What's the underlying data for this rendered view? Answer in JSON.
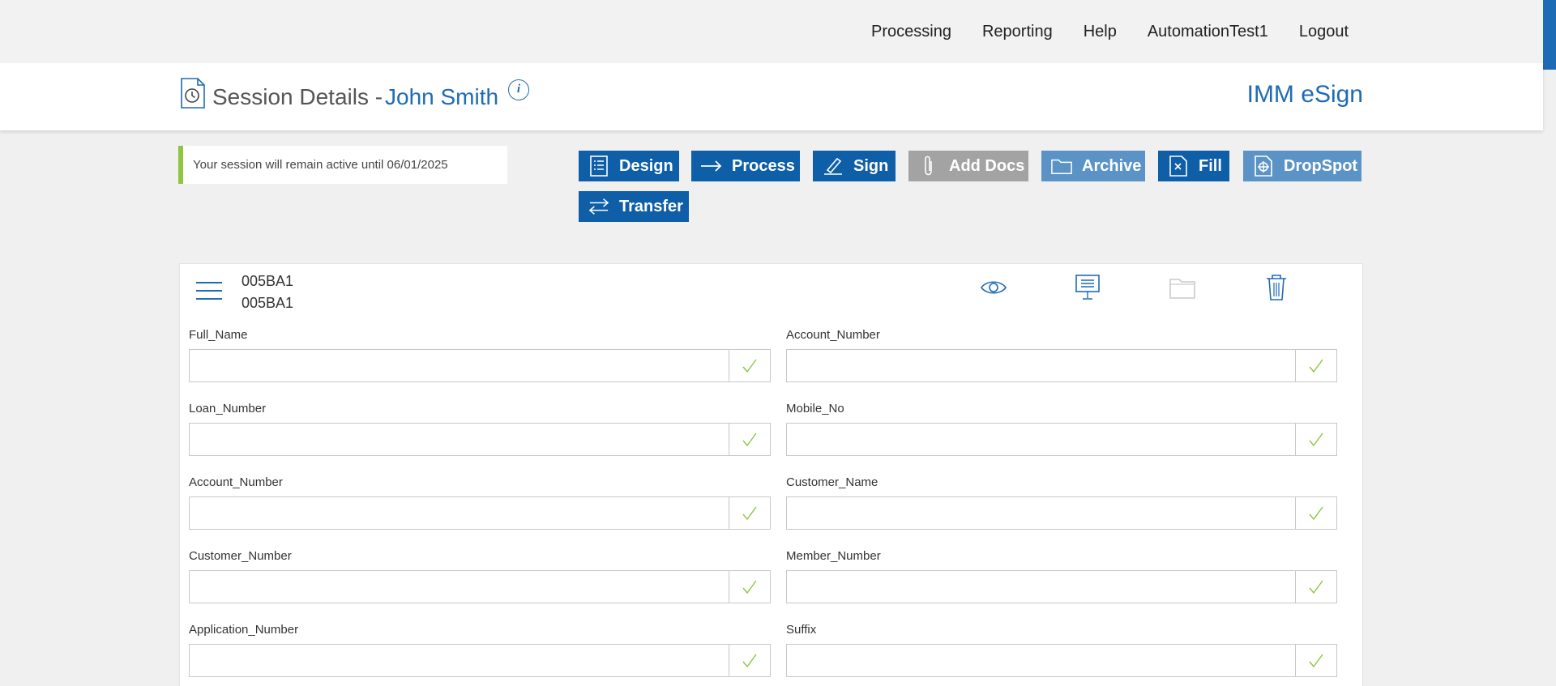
{
  "nav": {
    "items": [
      "Processing",
      "Reporting",
      "Help",
      "AutomationTest1",
      "Logout"
    ]
  },
  "header": {
    "title": "Session Details -",
    "user": "John Smith",
    "info": "i",
    "brand": "IMM eSign"
  },
  "notice": "Your session will remain active until 06/01/2025",
  "buttons": [
    {
      "label": "Design",
      "icon": "list-doc-icon",
      "style": "dark"
    },
    {
      "label": "Process",
      "icon": "arrow-right-icon",
      "style": "dark"
    },
    {
      "label": "Sign",
      "icon": "pen-icon",
      "style": "dark"
    },
    {
      "label": "Add Docs",
      "icon": "paperclip-icon",
      "style": "grey"
    },
    {
      "label": "Archive",
      "icon": "folder-icon",
      "style": "light"
    },
    {
      "label": "Fill",
      "icon": "fill-doc-icon",
      "style": "dark"
    },
    {
      "label": "DropSpot",
      "icon": "target-doc-icon",
      "style": "light"
    },
    {
      "label": "Transfer",
      "icon": "transfer-arrows-icon",
      "style": "dark"
    }
  ],
  "document": {
    "line1": "005BA1",
    "line2": "005BA1"
  },
  "colors": {
    "primary": "#0f5ea8",
    "accent_green": "#8dc63f",
    "disabled": "#a3a3a3",
    "light_blue": "#5b93c7"
  },
  "fields": [
    {
      "label": "Full_Name",
      "value": ""
    },
    {
      "label": "Account_Number",
      "value": ""
    },
    {
      "label": "Loan_Number",
      "value": ""
    },
    {
      "label": "Mobile_No",
      "value": ""
    },
    {
      "label": "Account_Number",
      "value": ""
    },
    {
      "label": "Customer_Name",
      "value": ""
    },
    {
      "label": "Customer_Number",
      "value": ""
    },
    {
      "label": "Member_Number",
      "value": ""
    },
    {
      "label": "Application_Number",
      "value": ""
    },
    {
      "label": "Suffix",
      "value": ""
    }
  ]
}
